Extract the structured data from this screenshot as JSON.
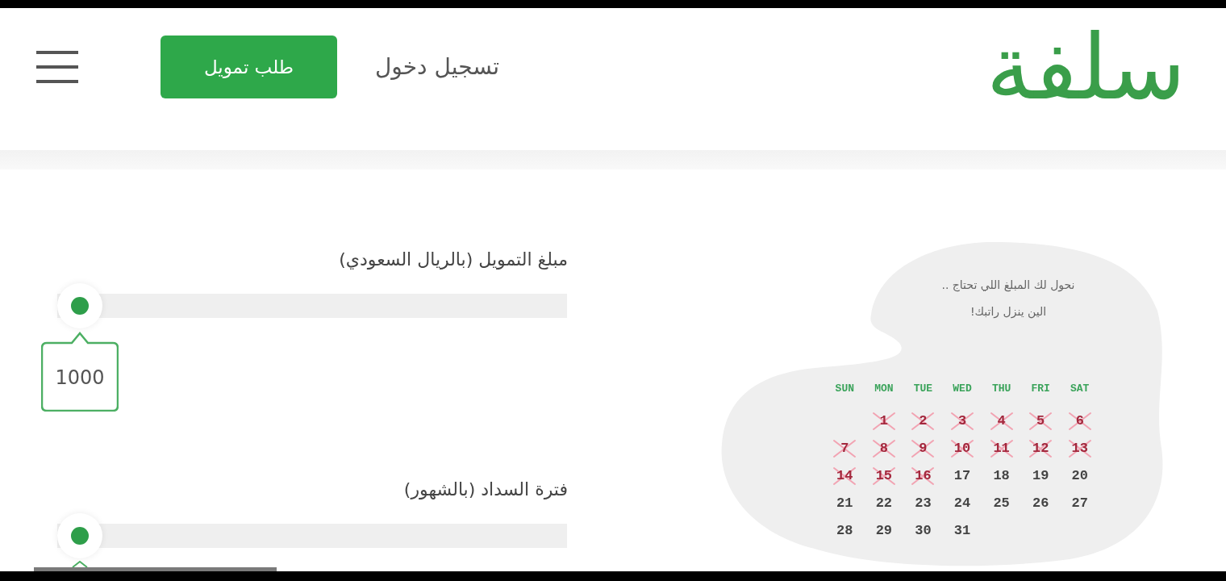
{
  "header": {
    "logo": "سلفة",
    "login_link": "تسجيل دخول",
    "cta_button": "طلب تمويل"
  },
  "sliders": [
    {
      "label": "مبلغ التمويل (بالريال السعودي)",
      "level": 0,
      "value": "1000"
    },
    {
      "label": "فترة السداد (بالشهور)",
      "level": 0
    }
  ],
  "promo": {
    "tagline": [
      "نحول لك المبلغ اللي تحتاج ..",
      "الين ينزل راتبك!"
    ],
    "calendar": {
      "weekdays": [
        "SAT",
        "FRI",
        "THU",
        "WED",
        "TUE",
        "MON",
        "SUN"
      ],
      "weeks": [
        [
          {
            "day": "6",
            "crossed": true
          },
          {
            "day": "5",
            "crossed": true
          },
          {
            "day": "4",
            "crossed": true
          },
          {
            "day": "3",
            "crossed": true
          },
          {
            "day": "2",
            "crossed": true
          },
          {
            "day": "1",
            "crossed": true
          }
        ],
        [
          {
            "day": "13",
            "crossed": true
          },
          {
            "day": "12",
            "crossed": true
          },
          {
            "day": "11",
            "crossed": true
          },
          {
            "day": "10",
            "crossed": true
          },
          {
            "day": "9",
            "crossed": true
          },
          {
            "day": "8",
            "crossed": true
          },
          {
            "day": "7",
            "crossed": true
          }
        ],
        [
          {
            "day": "20",
            "crossed": false
          },
          {
            "day": "19",
            "crossed": false
          },
          {
            "day": "18",
            "crossed": false
          },
          {
            "day": "17",
            "crossed": false
          },
          {
            "day": "16",
            "crossed": true
          },
          {
            "day": "15",
            "crossed": true
          },
          {
            "day": "14",
            "crossed": true
          }
        ],
        [
          {
            "day": "27",
            "crossed": false
          },
          {
            "day": "26",
            "crossed": false
          },
          {
            "day": "25",
            "crossed": false
          },
          {
            "day": "24",
            "crossed": false
          },
          {
            "day": "23",
            "crossed": false
          },
          {
            "day": "22",
            "crossed": false
          },
          {
            "day": "21",
            "crossed": false
          }
        ],
        [
          {
            "day": "31",
            "crossed": false
          },
          {
            "day": "30",
            "crossed": false
          },
          {
            "day": "29",
            "crossed": false
          },
          {
            "day": "28",
            "crossed": false
          }
        ]
      ]
    }
  }
}
